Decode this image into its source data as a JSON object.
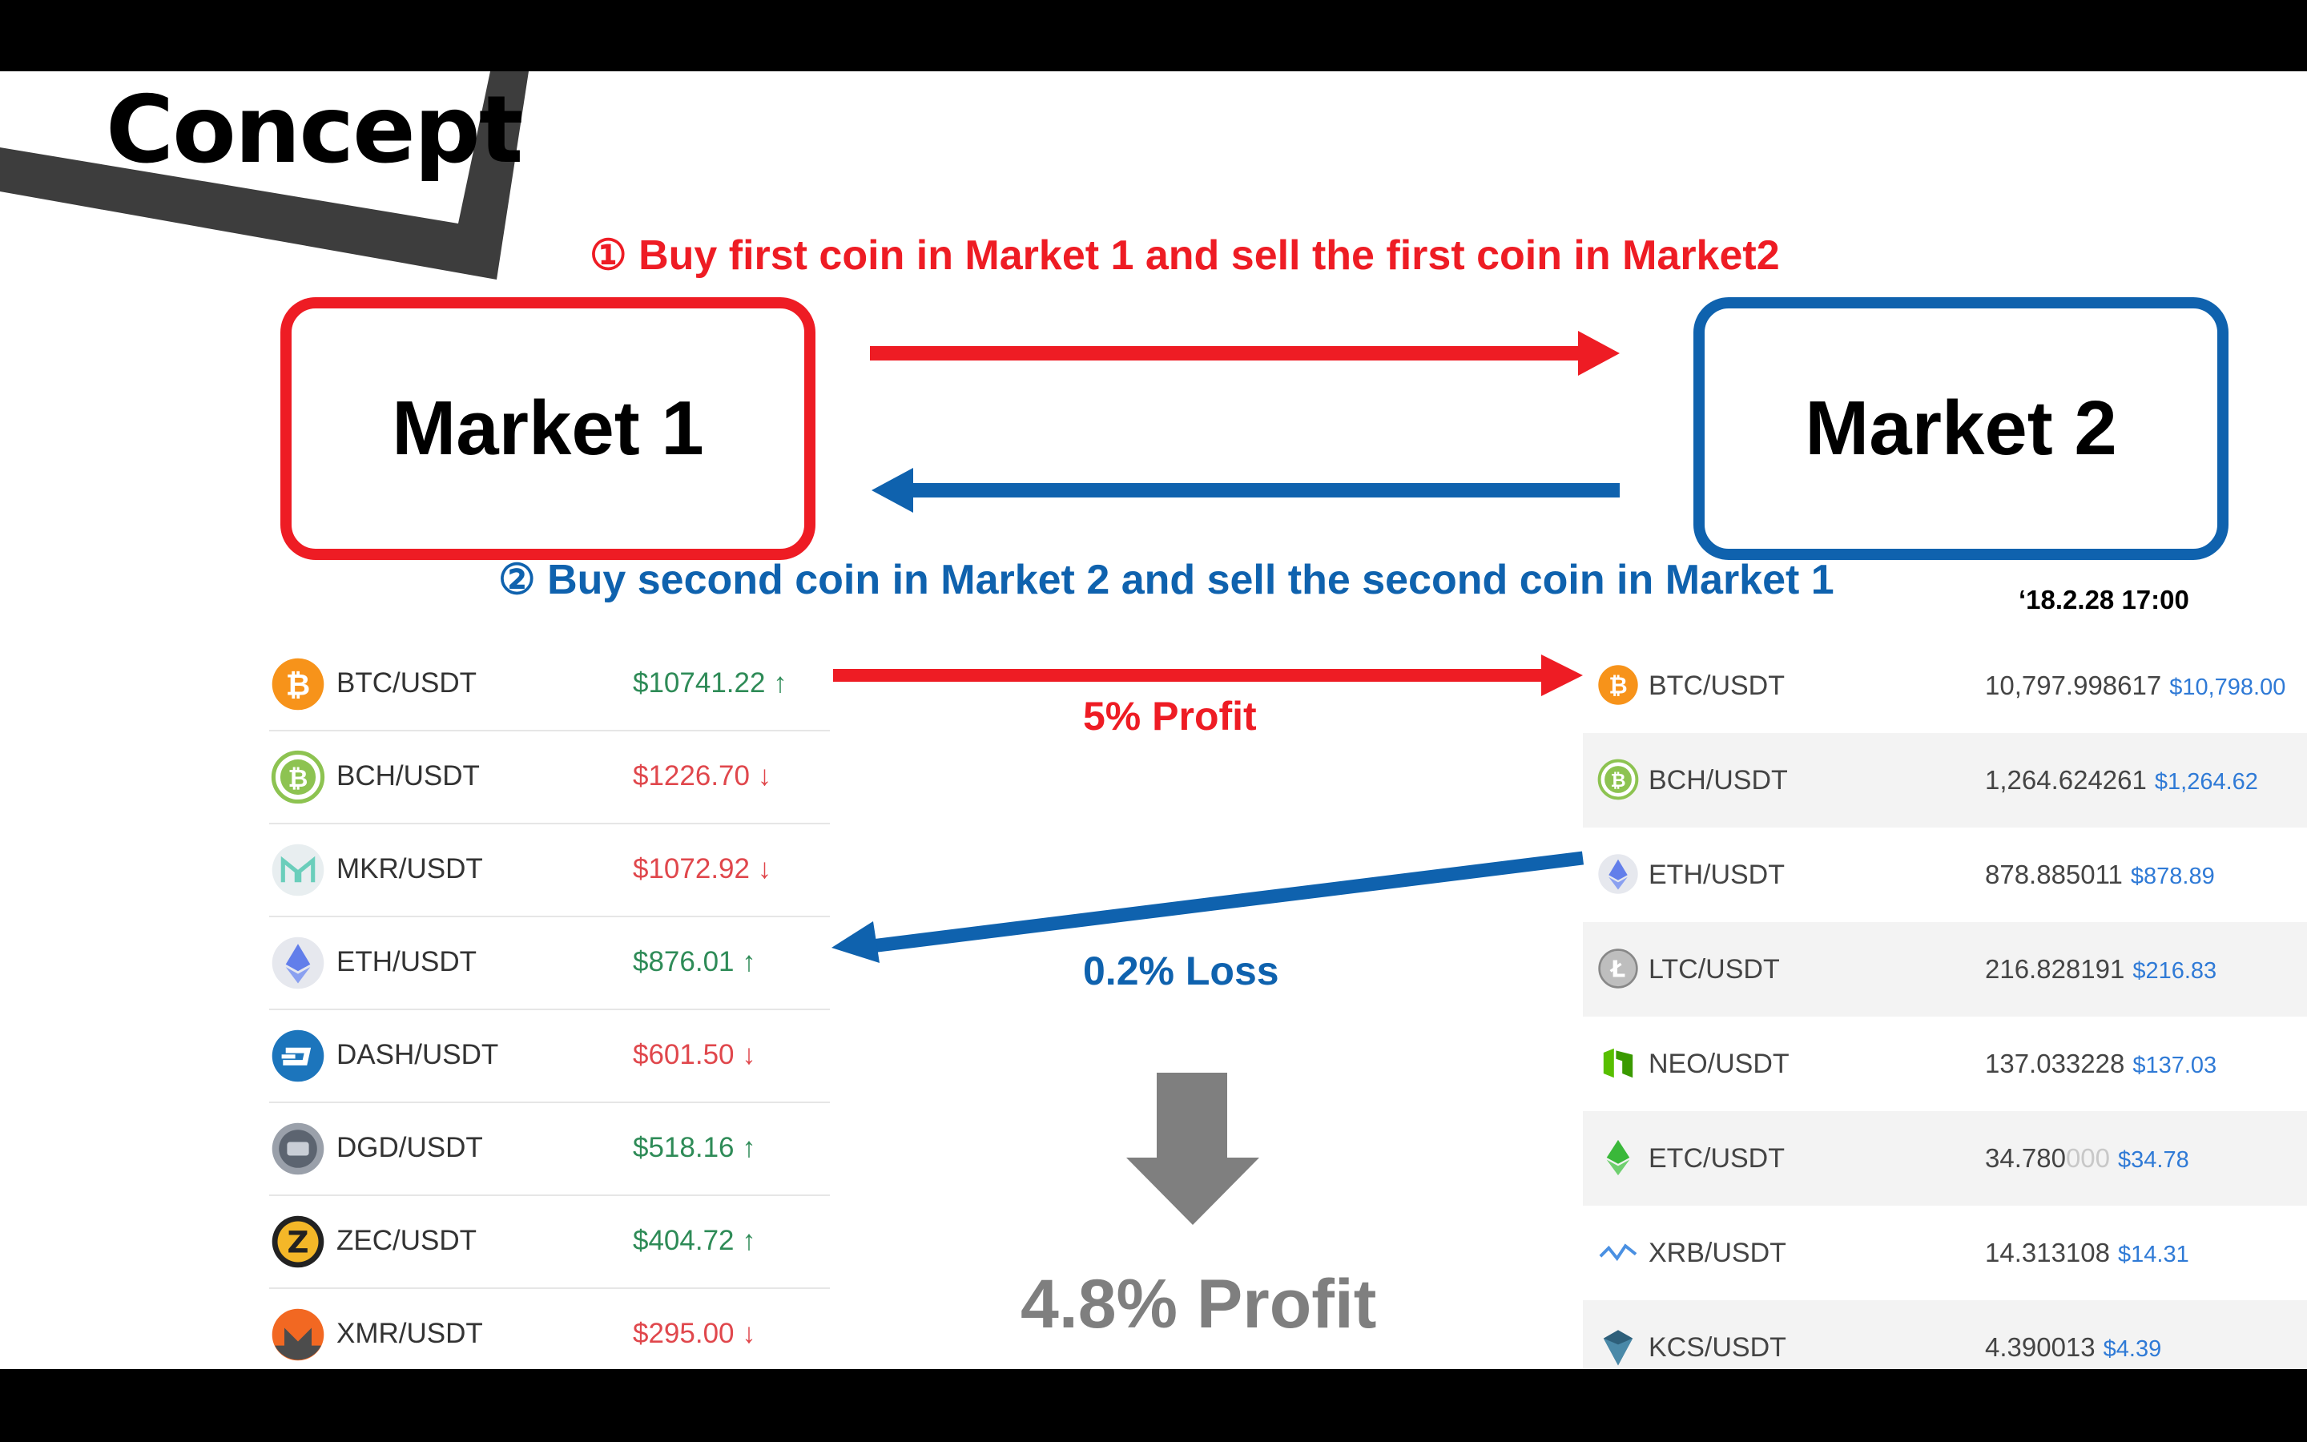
{
  "title": "Concept",
  "step1": "① Buy first coin in Market 1 and sell the first coin in Market2",
  "step2": "② Buy second coin in Market 2 and sell the second coin in Market 1",
  "market1": "Market 1",
  "market2": "Market 2",
  "timestamp": "‘18.2.28 17:00",
  "profit_label": "5% Profit",
  "loss_label": "0.2% Loss",
  "result": "4.8% Profit",
  "colors": {
    "red": "#ee1c24",
    "blue": "#0f62ae",
    "gray": "#7f7f7f",
    "up": "#2e8b57",
    "down": "#e0474c"
  },
  "market1_table": [
    {
      "pair": "BTC/USDT",
      "price": "$10741.22",
      "dir": "↑",
      "trend": "up",
      "icon": "bitcoin-icon"
    },
    {
      "pair": "BCH/USDT",
      "price": "$1226.70",
      "dir": "↓",
      "trend": "down",
      "icon": "bitcoin-cash-icon"
    },
    {
      "pair": "MKR/USDT",
      "price": "$1072.92",
      "dir": "↓",
      "trend": "down",
      "icon": "maker-icon"
    },
    {
      "pair": "ETH/USDT",
      "price": "$876.01",
      "dir": "↑",
      "trend": "up",
      "icon": "ethereum-icon"
    },
    {
      "pair": "DASH/USDT",
      "price": "$601.50",
      "dir": "↓",
      "trend": "down",
      "icon": "dash-icon"
    },
    {
      "pair": "DGD/USDT",
      "price": "$518.16",
      "dir": "↑",
      "trend": "up",
      "icon": "digixdao-icon"
    },
    {
      "pair": "ZEC/USDT",
      "price": "$404.72",
      "dir": "↑",
      "trend": "up",
      "icon": "zcash-icon"
    },
    {
      "pair": "XMR/USDT",
      "price": "$295.00",
      "dir": "↓",
      "trend": "down",
      "icon": "monero-icon"
    }
  ],
  "market2_table": [
    {
      "pair": "BTC/USDT",
      "price": "10,797.998617",
      "price_faded": "",
      "usd": "$10,798.00",
      "icon": "bitcoin-icon"
    },
    {
      "pair": "BCH/USDT",
      "price": "1,264.624261",
      "price_faded": "",
      "usd": "$1,264.62",
      "icon": "bitcoin-cash-icon"
    },
    {
      "pair": "ETH/USDT",
      "price": "878.885011",
      "price_faded": "",
      "usd": "$878.89",
      "icon": "ethereum-icon"
    },
    {
      "pair": "LTC/USDT",
      "price": "216.828191",
      "price_faded": "",
      "usd": "$216.83",
      "icon": "litecoin-icon"
    },
    {
      "pair": "NEO/USDT",
      "price": "137.033228",
      "price_faded": "",
      "usd": "$137.03",
      "icon": "neo-icon"
    },
    {
      "pair": "ETC/USDT",
      "price": "34.780",
      "price_faded": "000",
      "usd": "$34.78",
      "icon": "ethereum-classic-icon"
    },
    {
      "pair": "XRB/USDT",
      "price": "14.313108",
      "price_faded": "",
      "usd": "$14.31",
      "icon": "raiblocks-icon"
    },
    {
      "pair": "KCS/USDT",
      "price": "4.390013",
      "price_faded": "",
      "usd": "$4.39",
      "icon": "kucoin-icon"
    }
  ]
}
